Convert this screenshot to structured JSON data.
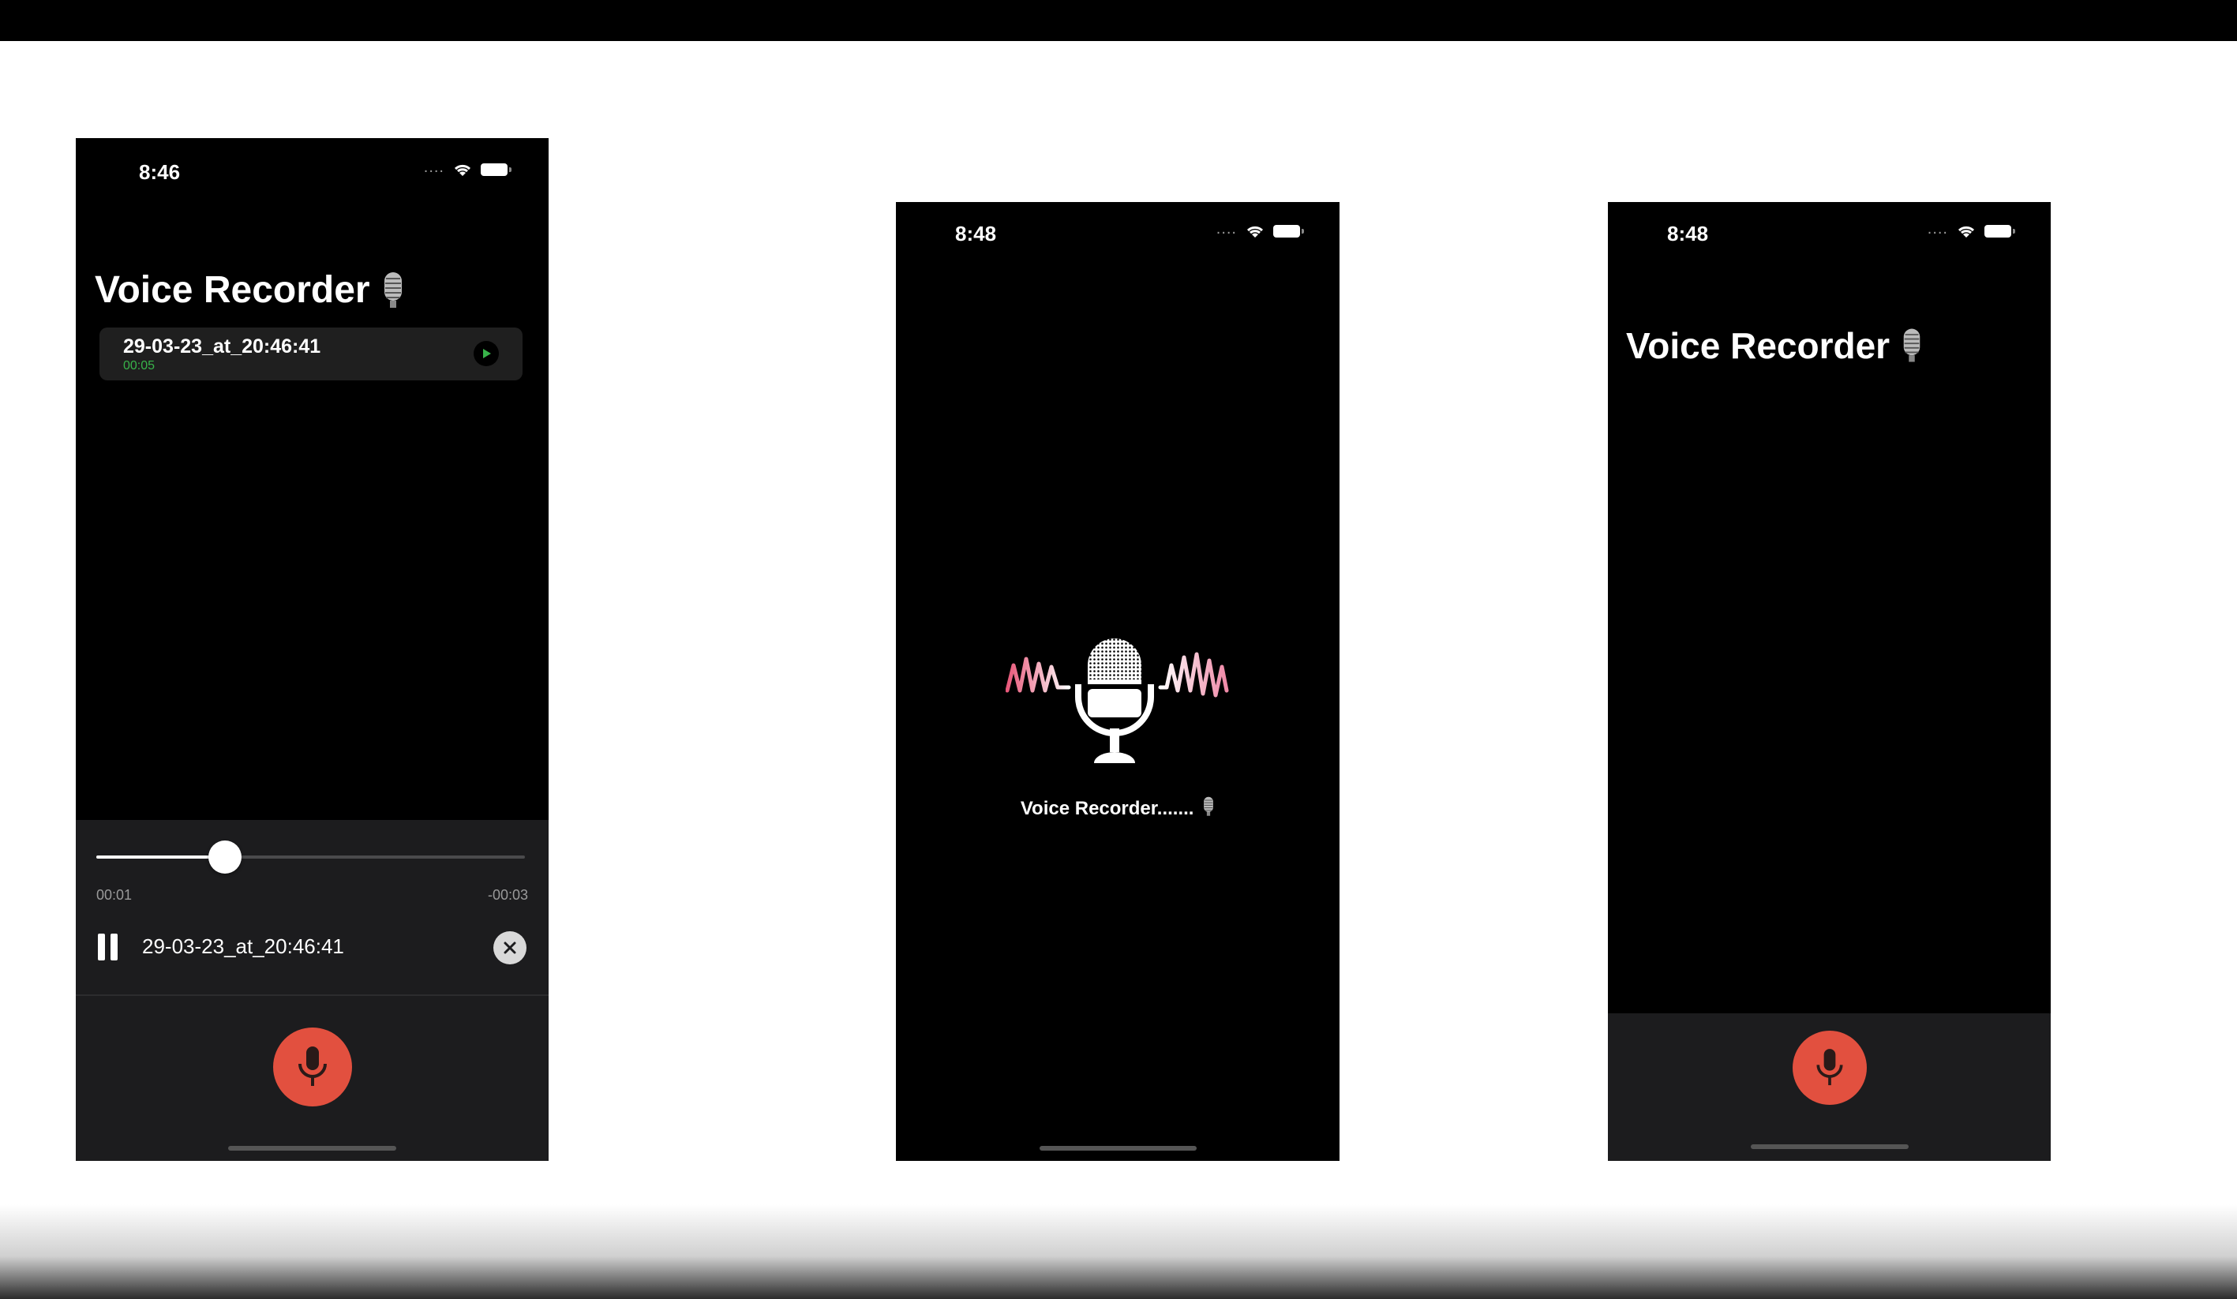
{
  "screens": [
    {
      "status": {
        "time": "8:46"
      },
      "title": "Voice Recorder",
      "recordings": [
        {
          "name": "29-03-23_at_20:46:41",
          "duration": "00:05"
        }
      ],
      "player": {
        "elapsed": "00:01",
        "remaining": "-00:03",
        "progress_fraction": 0.3,
        "file_name": "29-03-23_at_20:46:41"
      }
    },
    {
      "status": {
        "time": "8:48"
      },
      "splash_text": "Voice Recorder......."
    },
    {
      "status": {
        "time": "8:48"
      },
      "title": "Voice Recorder"
    }
  ],
  "colors": {
    "record_button": "#e2503f",
    "duration_text": "#38b34a",
    "waveform_left": "#e8587a",
    "waveform_right": "#f08aa8"
  },
  "icons": [
    "microphone-emoji-icon",
    "wifi-icon",
    "battery-icon",
    "play-icon",
    "pause-icon",
    "close-icon",
    "microphone-icon"
  ]
}
